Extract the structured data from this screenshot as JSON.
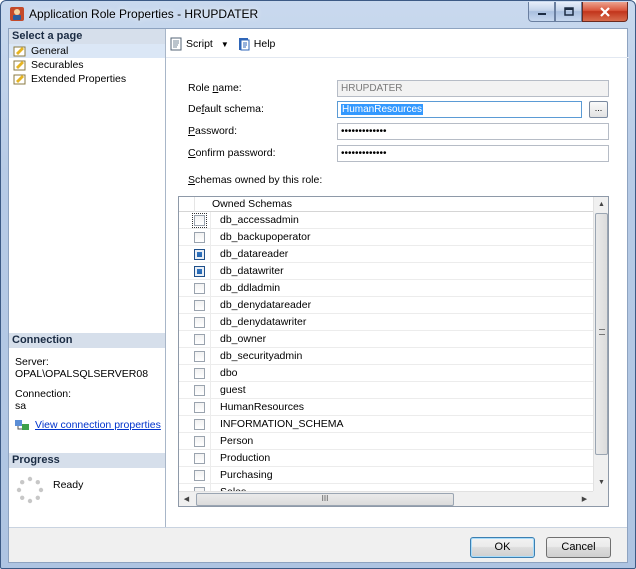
{
  "window": {
    "title": "Application Role Properties - HRUPDATER",
    "colors": {
      "frame": "#b7cbe6",
      "close": "#c2341b",
      "panel_header": "#d6dfeb"
    }
  },
  "left_pane": {
    "select_page_header": "Select a page",
    "pages": [
      {
        "label": "General",
        "icon": "page-settings-icon",
        "selected": true
      },
      {
        "label": "Securables",
        "icon": "page-settings-icon",
        "selected": false
      },
      {
        "label": "Extended Properties",
        "icon": "page-settings-icon",
        "selected": false
      }
    ],
    "connection_header": "Connection",
    "server_label": "Server:",
    "server_value": "OPAL\\OPALSQLSERVER08",
    "connection_label": "Connection:",
    "connection_value": "sa",
    "view_connection_link": "View connection properties",
    "progress_header": "Progress",
    "progress_status": "Ready"
  },
  "toolbar": {
    "script_label": "Script",
    "help_label": "Help"
  },
  "form": {
    "role_name_label_pre": "Role ",
    "role_name_label_u": "n",
    "role_name_label_post": "ame:",
    "role_name_value": "HRUPDATER",
    "default_schema_label_pre": "De",
    "default_schema_label_u": "f",
    "default_schema_label_post": "ault schema:",
    "default_schema_value": "HumanResources",
    "browse_label": "...",
    "password_label_u": "P",
    "password_label_post": "assword:",
    "password_value": "•••••••••••••",
    "confirm_password_label_u": "C",
    "confirm_password_label_post": "onfirm password:",
    "confirm_password_value": "•••••••••••••",
    "schemas_label_u": "S",
    "schemas_label_post": "chemas owned by this role:"
  },
  "grid": {
    "column_header": "Owned Schemas",
    "rows": [
      {
        "name": "db_accessadmin",
        "checked": false,
        "focused": true
      },
      {
        "name": "db_backupoperator",
        "checked": false
      },
      {
        "name": "db_datareader",
        "checked": true
      },
      {
        "name": "db_datawriter",
        "checked": true
      },
      {
        "name": "db_ddladmin",
        "checked": false
      },
      {
        "name": "db_denydatareader",
        "checked": false
      },
      {
        "name": "db_denydatawriter",
        "checked": false
      },
      {
        "name": "db_owner",
        "checked": false
      },
      {
        "name": "db_securityadmin",
        "checked": false
      },
      {
        "name": "dbo",
        "checked": false
      },
      {
        "name": "guest",
        "checked": false
      },
      {
        "name": "HumanResources",
        "checked": false
      },
      {
        "name": "INFORMATION_SCHEMA",
        "checked": false
      },
      {
        "name": "Person",
        "checked": false
      },
      {
        "name": "Production",
        "checked": false
      },
      {
        "name": "Purchasing",
        "checked": false
      },
      {
        "name": "Sales",
        "checked": false
      }
    ],
    "hscroll_grip": "III"
  },
  "buttons": {
    "ok_label": "OK",
    "cancel_label": "Cancel"
  }
}
